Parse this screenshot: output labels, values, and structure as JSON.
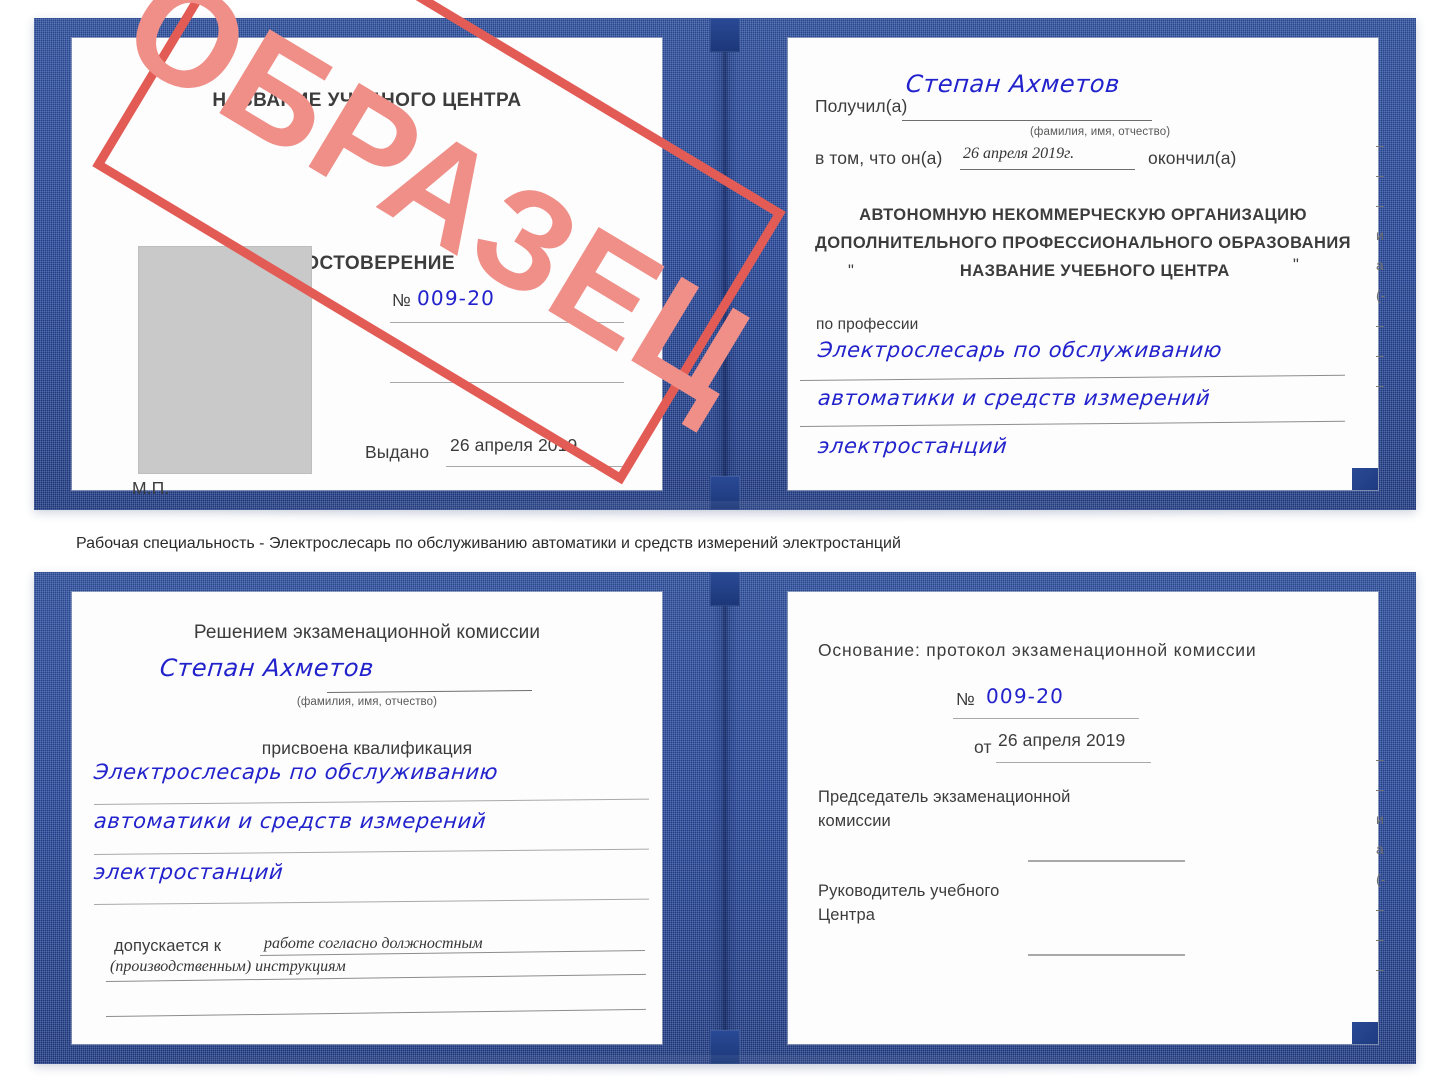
{
  "caption": "Рабочая специальность - Электрослесарь по обслуживанию автоматики и средств измерений электростанций",
  "stamp": {
    "label": "ОБРАЗЕЦ",
    "border_color": "#e25c55",
    "text_color": "#ef8f88"
  },
  "colors": {
    "cover_blue": "#27479b",
    "pen_blue": "#2222cc",
    "paper": "#fdfdfd",
    "photo_placeholder": "#c9c9c9",
    "rule_gray": "#8d8d8d"
  },
  "certificate_top": {
    "left_page": {
      "center_name": "НАЗВАНИЕ УЧЕБНОГО ЦЕНТРА",
      "doc_title": "УДОСТОВЕРЕНИЕ",
      "number_label": "№",
      "number_value": "009-20",
      "issued_label": "Выдано",
      "issued_value": "26 апреля 2019",
      "seal_label": "М.П."
    },
    "right_page": {
      "received_label": "Получил(а)",
      "received_value": "Степан Ахметов",
      "fio_hint": "(фамилия, имя, отчество)",
      "that_he_label": "в том, что он(а)",
      "that_he_value": "26 апреля 2019г.",
      "finished_label": "окончил(а)",
      "org_line1": "АВТОНОМНУЮ НЕКОММЕРЧЕСКУЮ ОРГАНИЗАЦИЮ",
      "org_line2": "ДОПОЛНИТЕЛЬНОГО ПРОФЕССИОНАЛЬНОГО ОБРАЗОВАНИЯ",
      "org_quote_open": "\"",
      "org_line3": "НАЗВАНИЕ УЧЕБНОГО ЦЕНТРА",
      "org_quote_close": "\"",
      "profession_label": "по профессии",
      "profession_line1": "Электрослесарь по обслуживанию",
      "profession_line2": "автоматики и средств измерений",
      "profession_line3": "электростанций"
    },
    "edge_marks": [
      "–",
      "–",
      "–",
      "и",
      "а",
      "(-",
      "–",
      "–",
      "–"
    ]
  },
  "certificate_bottom": {
    "left_page": {
      "heading": "Решением экзаменационной комиссии",
      "name_value": "Степан Ахметов",
      "fio_hint": "(фамилия, имя, отчество)",
      "qualification_label": "присвоена квалификация",
      "qualification_line1": "Электрослесарь по обслуживанию",
      "qualification_line2": "автоматики и средств измерений",
      "qualification_line3": "электростанций",
      "admitted_label": "допускается к",
      "admitted_line1": "работе согласно должностным",
      "admitted_line2": "(производственным) инструкциям"
    },
    "right_page": {
      "basis_label": "Основание: протокол экзаменационной комиссии",
      "number_label": "№",
      "number_value": "009-20",
      "date_label": "от",
      "date_value": "26 апреля 2019",
      "chairman_line1": "Председатель экзаменационной",
      "chairman_line2": "комиссии",
      "head_line1": "Руководитель учебного",
      "head_line2": "Центра"
    },
    "edge_marks": [
      "–",
      "–",
      "и",
      "а",
      "(-",
      "–",
      "–",
      "–"
    ]
  }
}
